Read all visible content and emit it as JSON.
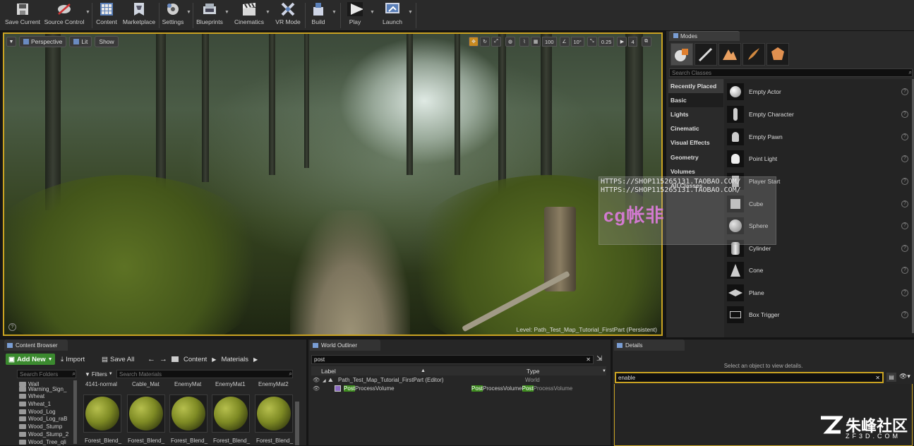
{
  "toolbar": {
    "items": [
      {
        "label": "Save Current",
        "icon": "save-icon"
      },
      {
        "label": "Source Control",
        "icon": "source-control-icon"
      },
      {
        "label": "Content",
        "icon": "content-icon"
      },
      {
        "label": "Marketplace",
        "icon": "marketplace-icon"
      },
      {
        "label": "Settings",
        "icon": "settings-icon"
      },
      {
        "label": "Blueprints",
        "icon": "blueprints-icon"
      },
      {
        "label": "Cinematics",
        "icon": "cinematics-icon"
      },
      {
        "label": "VR Mode",
        "icon": "vr-mode-icon"
      },
      {
        "label": "Build",
        "icon": "build-icon"
      },
      {
        "label": "Play",
        "icon": "play-icon"
      },
      {
        "label": "Launch",
        "icon": "launch-icon"
      }
    ]
  },
  "viewport": {
    "perspective": "Perspective",
    "lit": "Lit",
    "show": "Show",
    "grid_snap": "100",
    "rotation_snap": "10°",
    "scale_snap": "0.25",
    "camera_speed": "4",
    "level_label": "Level:  Path_Test_Map_Tutorial_FirstPart (Persistent)",
    "accent": "#caa322"
  },
  "modes": {
    "tab": "Modes",
    "search_placeholder": "Search Classes",
    "categories": [
      "Recently Placed",
      "Basic",
      "Lights",
      "Cinematic",
      "Visual Effects",
      "Geometry",
      "Volumes",
      "All Classes"
    ],
    "items": [
      "Empty Actor",
      "Empty Character",
      "Empty Pawn",
      "Point Light",
      "Player Start",
      "Cube",
      "Sphere",
      "Cylinder",
      "Cone",
      "Plane",
      "Box Trigger"
    ]
  },
  "watermark": {
    "line1": "HTTPS://SHOP115265131.TAOBAO.COM/",
    "line2": "HTTPS://SHOP115265131.TAOBAO.COM/",
    "logo": "cg帐非",
    "corner": "朱峰社区",
    "corner_sub": "ZF3D.COM"
  },
  "content_browser": {
    "tab": "Content Browser",
    "add_new": "Add New",
    "import": "Import",
    "save_all": "Save All",
    "path": [
      "Content",
      "Materials"
    ],
    "search_folders": "Search Folders",
    "filters": "Filters",
    "search_materials": "Search Materials",
    "folders": [
      "Wall",
      "Warning_Sign_",
      "Wheat",
      "Wheat_1",
      "Wood_Log",
      "Wood_Log_raB",
      "Wood_Stump",
      "Wood_Stump_2",
      "Wood_Tree_qli"
    ],
    "asset_top": [
      "4141-normal",
      "Cable_Mat",
      "EnemyMat",
      "EnemyMat1",
      "EnemyMat2"
    ],
    "asset_bottom": [
      "Forest_Blend_",
      "Forest_Blend_",
      "Forest_Blend_",
      "Forest_Blend_",
      "Forest_Blend_"
    ]
  },
  "outliner": {
    "tab": "World Outliner",
    "search": "post",
    "col_label": "Label",
    "col_type": "Type",
    "rows": [
      {
        "label": "Path_Test_Map_Tutorial_FirstPart (Editor)",
        "type": "World"
      },
      {
        "label_hl": "Post",
        "label_rest": "ProcessVolume",
        "type_hl1": "Post",
        "type_rest1": "ProcessVolume",
        "type_hl2": "Post",
        "type_rest2": "ProcessVolume"
      }
    ]
  },
  "details": {
    "tab": "Details",
    "hint": "Select an object to view details.",
    "search": "enable"
  }
}
